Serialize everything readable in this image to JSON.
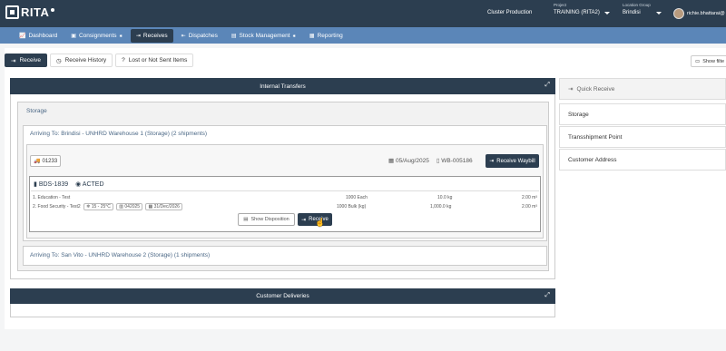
{
  "app": {
    "logo_text": "RITA"
  },
  "header": {
    "cluster": "Cluster Production",
    "project_label": "Project",
    "project_value": "TRAINING (RITA2)",
    "location_label": "Location Group",
    "location_value": "Brindisi",
    "user": "richie.bhattarai@"
  },
  "nav": {
    "items": [
      {
        "label": "Dashboard",
        "icon": "chart-icon"
      },
      {
        "label": "Consignments",
        "icon": "truck-icon",
        "star": "✱"
      },
      {
        "label": "Receives",
        "icon": "sign-in-icon",
        "active": true
      },
      {
        "label": "Dispatches",
        "icon": "sign-out-icon"
      },
      {
        "label": "Stock Management",
        "icon": "stock-icon",
        "star": "✱"
      },
      {
        "label": "Reporting",
        "icon": "report-icon"
      }
    ]
  },
  "subtabs": {
    "receive": "Receive",
    "history": "Receive History",
    "lost": "Lost or Not Sent Items"
  },
  "filter": {
    "label": "Show filte"
  },
  "internal": {
    "title": "Internal Transfers",
    "storage_title": "Storage",
    "arriving1": "Arriving To: Brindisi - UNHRD Warehouse 1 (Storage) (2 shipments)",
    "arriving2": "Arriving To: San Vito - UNHRD Warehouse 2 (Storage) (1 shipments)",
    "shipment": {
      "truck_id": "01233",
      "date": "05/Aug/2025",
      "waybill": "WB-005186",
      "receive_waybill": "Receive Waybill",
      "code": "BDS-1839",
      "org": "ACTED",
      "items": [
        {
          "name": "1. Education - Test",
          "qty": "1000 Each",
          "weight": "10.0 kg",
          "volume": "2.00 m³"
        },
        {
          "name": "2. Food Security - Test2",
          "temp": "15 - 25°C",
          "batch": "042025",
          "expiry": "31/Dec/2026",
          "qty": "1000 Bulk (kg)",
          "weight": "1,000.0 kg",
          "volume": "2.00 m³"
        }
      ],
      "show_disposition": "Show Disposition",
      "receive": "Receive"
    }
  },
  "customer": {
    "title": "Customer Deliveries"
  },
  "sidebar": {
    "quick_receive": "Quick Receive",
    "items": [
      "Storage",
      "Transshipment Point",
      "Customer Address"
    ]
  },
  "colors": {
    "header": "#2c3e50",
    "nav": "#5b86b8",
    "accent_text": "#4a6785"
  }
}
